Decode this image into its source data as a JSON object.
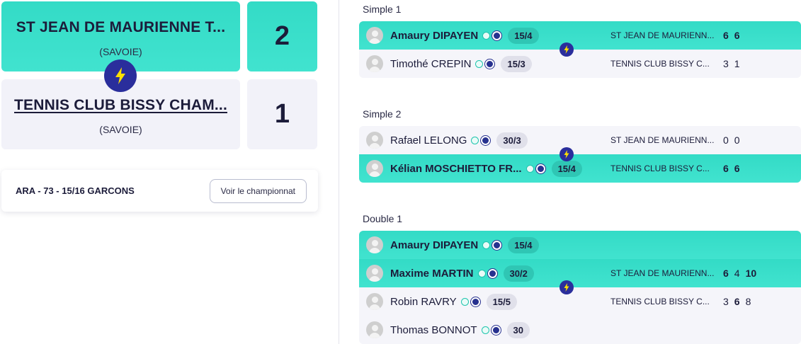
{
  "home_team": {
    "name": "ST JEAN DE MAURIENNE T...",
    "region": "(SAVOIE)",
    "score": "2"
  },
  "away_team": {
    "name": "TENNIS CLUB BISSY CHAM...",
    "region": "(SAVOIE)",
    "score": "1"
  },
  "championship": {
    "label": "ARA - 73 - 15/16 GARCONS",
    "button": "Voir le championnat"
  },
  "matches": [
    {
      "title": "Simple 1",
      "rows": [
        {
          "name": "Amaury DIPAYEN",
          "rank": "15/4",
          "club": "ST JEAN DE MAURIENN...",
          "sets": [
            "6",
            "6"
          ]
        },
        {
          "name": "Timothé CREPIN",
          "rank": "15/3",
          "club": "TENNIS CLUB BISSY C...",
          "sets": [
            "3",
            "1"
          ]
        }
      ]
    },
    {
      "title": "Simple 2",
      "rows": [
        {
          "name": "Rafael LELONG",
          "rank": "30/3",
          "club": "ST JEAN DE MAURIENN...",
          "sets": [
            "0",
            "0"
          ]
        },
        {
          "name": "Kélian MOSCHIETTO FR...",
          "rank": "15/4",
          "club": "TENNIS CLUB BISSY C...",
          "sets": [
            "6",
            "6"
          ]
        }
      ]
    },
    {
      "title": "Double 1",
      "players": [
        {
          "name": "Amaury DIPAYEN",
          "rank": "15/4"
        },
        {
          "name": "Maxime MARTIN",
          "rank": "30/2"
        },
        {
          "name": "Robin RAVRY",
          "rank": "15/5"
        },
        {
          "name": "Thomas BONNOT",
          "rank": "30"
        }
      ],
      "home_club": "ST JEAN DE MAURIENN...",
      "away_club": "TENNIS CLUB BISSY C...",
      "home_sets": [
        "6",
        "4",
        "10"
      ],
      "away_sets": [
        "3",
        "6",
        "8"
      ]
    }
  ],
  "colors": {
    "win": "#3ddfca",
    "neutral": "#f2f2f9",
    "accent": "#2a2e9c",
    "bolt": "#ffe000"
  },
  "icons": {
    "vs": "lightning-icon",
    "player": "avatar-icon",
    "ball": "tennis-ball-icon",
    "flag": "flag-icon"
  }
}
